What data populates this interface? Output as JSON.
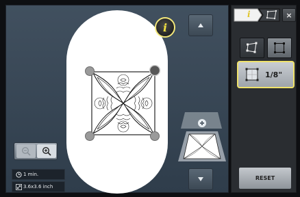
{
  "workarea": {
    "info_button_glyph": "i",
    "scroll_up_icon": "arrow-up-icon",
    "scroll_down_icon": "arrow-down-icon"
  },
  "zoom": {
    "zoom_out_icon": "zoom-out-icon",
    "zoom_in_icon": "zoom-in-icon"
  },
  "status": {
    "time": "1 min.",
    "size": "3.6x3.6 inch"
  },
  "panel": {
    "tab_info_glyph": "i",
    "grid_value": "1/8\"",
    "reset_label": "RESET",
    "close_label": "×"
  },
  "colors": {
    "accent_yellow": "#efe26a",
    "hoop_white": "#ffffff",
    "workarea_blue": "#3b4a59"
  }
}
